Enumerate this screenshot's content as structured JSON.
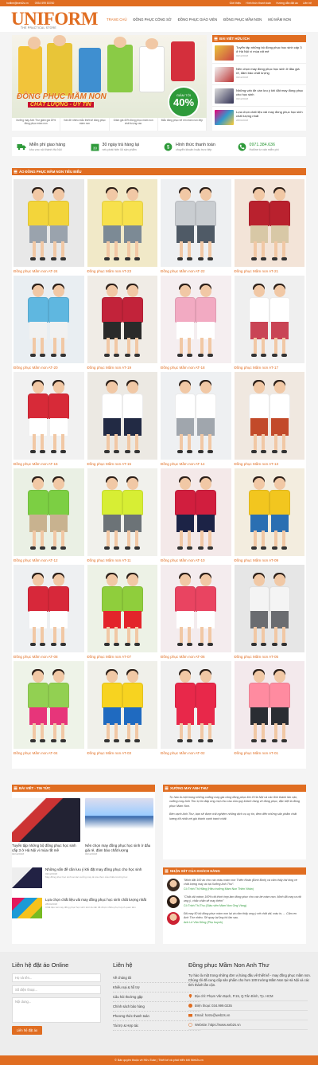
{
  "topbar": {
    "email": "hotline@web2s.vn",
    "phone": "0934 599 83760",
    "links": [
      "Giới thiệu",
      "Hình thức thanh toán",
      "Hướng dẫn đặt áo",
      "Liên hệ"
    ]
  },
  "logo": {
    "text": "UNIFORM",
    "tagline": "THE PRACTICAL STORE"
  },
  "nav": [
    "TRANG CHỦ",
    "ĐỒNG PHỤC CÔNG SỞ",
    "ĐỒNG PHỤC GIÁO VIÊN",
    "ĐỒNG PHỤC MẦM NON",
    "MŨ MẦM NON"
  ],
  "hero": {
    "title": "ĐỒNG PHỤC MẦM NON",
    "subtitle": "CHẤT LƯỢNG - UY TÍN",
    "badge_top": "GIẢM TỚI",
    "badge_value": "40%",
    "thumbs": [
      "Xưởng may Anh Thư giảm giá 20% đồng phục mầm non",
      "Vấn đề nhiều mẫu thiết kế đồng phục mầm non",
      "Giảm giá 40% đồng phục mầm non chất lượng cao",
      "Mẫu đồng phục trẻ em mầm non đẹp"
    ]
  },
  "sidebar": {
    "title": "BÀI VIẾT HỮU ÍCH",
    "items": [
      {
        "title": "Tuyển tập những bộ đồng phục học sinh cấp 3 ở Hà Nội vì mùa rất mê",
        "date": "02/12/2018"
      },
      {
        "title": "Nên chọn may đồng phục học sinh ở đâu giá rẻ, đảm bảo chất lượng",
        "date": "03/12/2018"
      },
      {
        "title": "Những vấn đề cần lưu ý khi đặt may đồng phục cho học sinh",
        "date": "03/12/2018"
      },
      {
        "title": "Lựa chọn chất liệu vải may đồng phục học sinh chất lượng nhất",
        "date": "28/04/2018"
      }
    ]
  },
  "services": [
    {
      "title": "Miễn phí giao hàng",
      "sub": "khu vực nội thành Hà Nội"
    },
    {
      "title": "30 ngày trả hàng lại",
      "sub": "nếu phát hiện lỗi sản phẩm"
    },
    {
      "title": "Hình thức thanh toán",
      "sub": "chuyển khoản hoặc trực tiếp"
    },
    {
      "title": "0971.384.636",
      "sub": "Hotline tư vấn miễn phí"
    }
  ],
  "products": {
    "title": "ÁO ĐỒNG PHỤC MẦM NON TIÊU BIỂU",
    "items": [
      "Đồng phục Mầm non AT-24",
      "Đồng phục Mầm non AT-23",
      "Đồng phục Mầm non AT-22",
      "Đồng phục Mầm non AT-21",
      "Đồng phục Mầm non AT-20",
      "Đồng phục Mầm non AT-19",
      "Đồng phục Mầm non AT-18",
      "Đồng phục Mầm non AT-17",
      "Đồng phục Mầm non AT-16",
      "Đồng phục Mầm non AT-15",
      "Đồng phục Mầm non AT-14",
      "Đồng phục Mầm non AT-13",
      "Đồng phục Mầm non AT-12",
      "Đồng phục Mầm non AT-11",
      "Đồng phục Mầm non AT-10",
      "Đồng phục Mầm non AT-09",
      "Đồng phục Mầm non AT-08",
      "Đồng phục Mầm non AT-07",
      "Đồng phục Mầm non AT-06",
      "Đồng phục Mầm non AT-05",
      "Đồng phục Mầm non AT-04",
      "Đồng phục Mầm non AT-03",
      "Đồng phục Mầm non AT-02",
      "Đồng phục Mầm non AT-01"
    ]
  },
  "news": {
    "title": "BÀI VIẾT - TIN TỨC",
    "featured": [
      {
        "title": "Tuyển tập những bộ đồng phục học sinh cấp 3 ở Hà Nội vì mùa rất mê",
        "date": "02/12/2018"
      },
      {
        "title": "Nên chọn may đồng phục học sinh ở đâu giá rẻ, đảm bảo chất lượng",
        "date": "03/12/2018"
      }
    ],
    "list": [
      {
        "title": "Những vấn đề cần lưu ý khi đặt may đồng phục cho học sinh",
        "date": "03/12/2018",
        "excerpt": "May đồng phục học sinh tại các xưởng may là lựa chọn của nhiều trường học"
      },
      {
        "title": "Lựa chọn chất liệu vải may đồng phục học sinh chất lượng nhất",
        "date": "28/04/2018",
        "excerpt": "Chất liệu vải may đồng phục học sinh luôn là vấn đề được nhiều phụ huynh quan tâm"
      }
    ]
  },
  "about": {
    "title": "XƯỞNG MAY ANH THƯ",
    "p1": "Tự hào là một trong những xưởng may gia công đồng phục lớn ở Hà Nội và các tỉnh thành lân cận, xưởng may Anh Thư tự tin đáp ứng mọi nhu cầu của quý khách hàng về đồng phục, đặc biệt là đồng phục Mầm Non.",
    "p2": "Bên cạnh Anh Thư, bạn sẽ được trải nghiệm những dịch vụ uy tín, đem đến những sản phẩm chất lượng tốt nhất với giá thành cạnh tranh nhất."
  },
  "testimonials": {
    "title": "NHẬN XÉT CỦA KHÁCH HÀNG",
    "items": [
      {
        "quote": "\"Mình đặt 100 áo cho các cháu mầm non Thiên Nhân (Bình Đinh) và cảm thấy hài lòng về chất lượng may áo tại Xưởng Anh Thư\".",
        "name": "Cô Trịnh Thị Hằng (Hiệu trưởng Mầm Non Thiên Nhân)"
      },
      {
        "quote": "\"Chất vải cotton 100% rất thích hợp làm đồng phục cho các bé mầm non. Mình đã may ra rất ưng ý, chắc chắn sẽ may thêm\"",
        "name": "Cô Trịnh Thị Thu (Giáo viên Mầm Non Ong Vàng)"
      },
      {
        "quote": "Đã may 50 bộ đồng phục mầm non lại và cảm thấy ưng ý với chất vải, màu in, ... Cảm ơn Anh Thư nhiều. Sẽ quay lại ủng hộ lần sau.",
        "name": "Anh Lê Văn Dũng (Phụ huynh)"
      }
    ]
  },
  "footer": {
    "form": {
      "title": "Liên hệ đặt áo Online",
      "name_ph": "Họ và tên...",
      "phone_ph": "Số điện thoại...",
      "content_ph": "Nội dung...",
      "submit": "Liên hệ đặt áo"
    },
    "links": {
      "title": "Liên hệ",
      "items": [
        "Về chúng tôi",
        "Khiếu nại & hỗ trợ",
        "Câu hỏi thường gặp",
        "Chính sách bảo hàng",
        "Phương thức thanh toán",
        "Tài trợ & Hợp tác"
      ]
    },
    "company": {
      "title": "Đồng phục Mầm Non Anh Thư",
      "desc": "Tự hào là một trong những đơn vị hàng đầu về thiết kế - may đồng phục mầm non. Chúng tôi đã cung cấp sản phẩm cho hơn 100 trường Mầm Non tại Hà Nội và các tỉnh thành lân cận.",
      "address": "Địa chỉ: Phạm Văn Bạch, P.15, Q.Tân Bình, Tp. HCM",
      "phone": "Điện thoại: 034.999.0235",
      "email": "Email: hotro@web2s.vn",
      "website": "Website: https://www.web2s.vn"
    },
    "copyright": "© Bản quyền thuộc về Hữu Toàn | Thiết kế và phát triển bởi Web2s.vn"
  },
  "colors": {
    "accent": "#e06d21",
    "green": "#2e9a3a"
  }
}
